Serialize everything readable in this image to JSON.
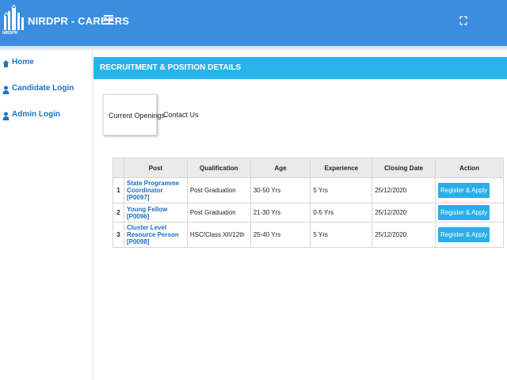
{
  "header": {
    "logo_text": "NIRDPR",
    "brand": "NIRDPR - CAREERS"
  },
  "sidebar": {
    "items": [
      {
        "label": "Home",
        "icon": "home-icon"
      },
      {
        "label": "Candidate Login",
        "icon": "user-icon"
      },
      {
        "label": "Admin Login",
        "icon": "user-icon"
      }
    ]
  },
  "main": {
    "section_title": "RECRUITMENT & POSITION DETAILS",
    "tabs": [
      {
        "label": "Current Openings",
        "active": true
      },
      {
        "label": "Contact Us",
        "active": false
      }
    ],
    "table": {
      "headers": [
        "",
        "Post",
        "Qualification",
        "Age",
        "Experience",
        "Closing Date",
        "Action"
      ],
      "rows": [
        {
          "no": "1",
          "post": "State Programme Coordinator [P0097]",
          "qualification": "Post Graduation",
          "age": "30-50 Yrs",
          "experience": "5 Yrs",
          "closing": "25/12/2020",
          "action": "Register & Apply"
        },
        {
          "no": "2",
          "post": "Young Fellow [P0096]",
          "qualification": "Post Graduation",
          "age": "21-30 Yrs",
          "experience": "0-5 Yrs",
          "closing": "25/12/2020",
          "action": "Register & Apply"
        },
        {
          "no": "3",
          "post": "Cluster Level Resource Person [P0098]",
          "qualification": "HSC/Class XII/12th",
          "age": "25-40 Yrs",
          "experience": "5 Yrs",
          "closing": "25/12/2020",
          "action": "Register & Apply"
        }
      ]
    }
  },
  "colors": {
    "topbar": "#3c8dde",
    "section_header": "#29b3ec",
    "link": "#1b73c9",
    "button": "#2aaeea"
  }
}
